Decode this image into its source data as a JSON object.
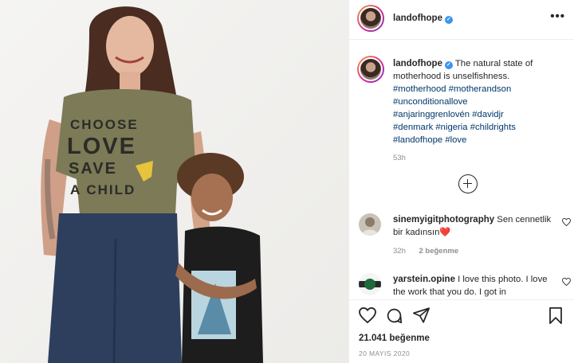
{
  "post": {
    "photo_shirt_lines": [
      "CHOOSE",
      "LOVE",
      "SAVE",
      "A CHILD"
    ],
    "photo_peace_symbol": "☮"
  },
  "header": {
    "username": "landofhope",
    "verified_icon": "✓",
    "more_icon": "•••"
  },
  "caption": {
    "username": "landofhope",
    "text": " The natural state of motherhood is unselfishness.",
    "hashtags": [
      "#motherhood",
      "#motherandson",
      "#unconditionallove",
      "#anjaringgrenlovén",
      "#davidjr",
      "#denmark",
      "#nigeria",
      "#childrights",
      "#landofhope",
      "#love"
    ],
    "time": "53h"
  },
  "comments": [
    {
      "username": "sinemyigitphotography",
      "text": " Sen cennetlik bir kadınsın",
      "emoji": "❤️",
      "time": "32h",
      "likes": "2 beğenme"
    },
    {
      "username": "yarstein.opine",
      "text": " I love this photo. I love the work that you do. I got in"
    }
  ],
  "footer": {
    "likes": "21.041 beğenme",
    "date": "20 MAYIS 2020"
  },
  "colors": {
    "link": "#00376b",
    "verified": "#3897f0",
    "muted": "#8e8e8e",
    "heart": "#ed1c24"
  },
  "icons": [
    "heart-icon",
    "comment-icon",
    "share-icon",
    "bookmark-icon",
    "add-comment-icon",
    "more-icon",
    "verified-badge-icon"
  ]
}
